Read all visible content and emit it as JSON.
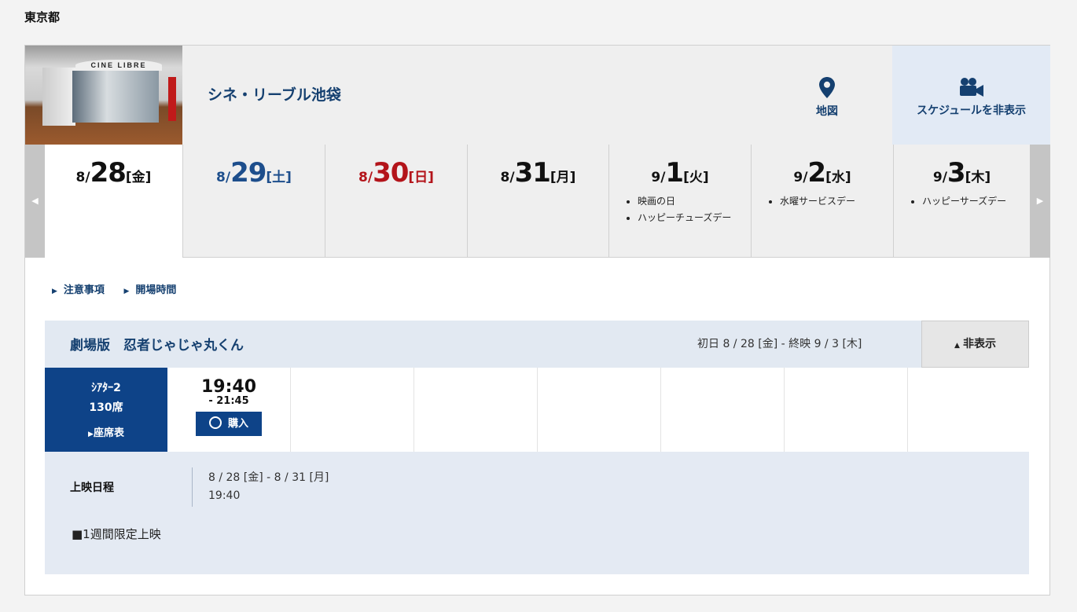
{
  "prefecture": "東京都",
  "theater": {
    "name": "シネ・リーブル池袋",
    "photo_sign": "CINE LIBRE",
    "map_label": "地図",
    "schedule_toggle_label": "スケジュールを非表示"
  },
  "date_tabs": [
    {
      "md": "8/",
      "day": "28",
      "weekday": "[金]",
      "color": "black",
      "active": true,
      "notes": []
    },
    {
      "md": "8/",
      "day": "29",
      "weekday": "[土]",
      "color": "blue",
      "active": false,
      "notes": []
    },
    {
      "md": "8/",
      "day": "30",
      "weekday": "[日]",
      "color": "red",
      "active": false,
      "notes": []
    },
    {
      "md": "8/",
      "day": "31",
      "weekday": "[月]",
      "color": "black",
      "active": false,
      "notes": []
    },
    {
      "md": "9/",
      "day": "1",
      "weekday": "[火]",
      "color": "black",
      "active": false,
      "notes": [
        "映画の日",
        "ハッピーチューズデー"
      ]
    },
    {
      "md": "9/",
      "day": "2",
      "weekday": "[水]",
      "color": "black",
      "active": false,
      "notes": [
        "水曜サービスデー"
      ]
    },
    {
      "md": "9/",
      "day": "3",
      "weekday": "[木]",
      "color": "black",
      "active": false,
      "notes": [
        "ハッピーサーズデー"
      ]
    }
  ],
  "nav": {
    "prev": "◀",
    "next": "▶"
  },
  "links": {
    "caution": "注意事項",
    "opening": "開場時間"
  },
  "film": {
    "title": "劇場版　忍者じゃじゃ丸くん",
    "period": "初日 8 / 28 [金] - 終映 9 / 3 [木]",
    "hide_label": "非表示",
    "screen": {
      "name": "ｼｱﾀｰ2",
      "seats": "130席",
      "seatmap_label": "座席表"
    },
    "showtimes": [
      {
        "start": "19:40",
        "end": "- 21:45",
        "buy_label": "購入"
      }
    ],
    "schedule_label": "上映日程",
    "schedule_dates": "8 / 28 [金] - 8 / 31 [月]",
    "schedule_time": "19:40",
    "note": "■1週間限定上映"
  },
  "colors": {
    "navy": "#0e4388",
    "blue_text": "#154070",
    "sunday": "#b3141a",
    "saturday": "#1d4e8c"
  }
}
